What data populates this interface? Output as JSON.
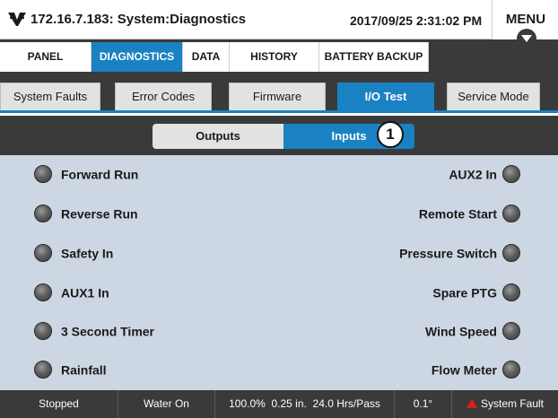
{
  "titlebar": {
    "title": "172.16.7.183: System:Diagnostics",
    "datetime": "2017/09/25 2:31:02 PM",
    "menu_label": "MENU",
    "logo_icon": "rain-bird-logo-icon",
    "menu_arrow_icon": "chevron-down-icon"
  },
  "main_tabs": [
    {
      "label": "PANEL",
      "active": false
    },
    {
      "label": "DIAGNOSTICS",
      "active": true
    },
    {
      "label": "DATA",
      "active": false
    },
    {
      "label": "HISTORY",
      "active": false
    },
    {
      "label": "BATTERY BACKUP",
      "active": false
    }
  ],
  "sub_tabs": [
    {
      "label": "System Faults",
      "active": false
    },
    {
      "label": "Error Codes",
      "active": false
    },
    {
      "label": "Firmware",
      "active": false
    },
    {
      "label": "I/O Test",
      "active": true
    },
    {
      "label": "Service Mode",
      "active": false
    }
  ],
  "toggle": {
    "outputs_label": "Outputs",
    "inputs_label": "Inputs",
    "selected": "Inputs",
    "callout": "1"
  },
  "inputs_left": [
    {
      "label": "Forward Run",
      "state": "off"
    },
    {
      "label": "Reverse Run",
      "state": "off"
    },
    {
      "label": "Safety In",
      "state": "off"
    },
    {
      "label": "AUX1 In",
      "state": "off"
    },
    {
      "label": "3 Second Timer",
      "state": "off"
    },
    {
      "label": "Rainfall",
      "state": "off"
    }
  ],
  "inputs_right": [
    {
      "label": "AUX2 In",
      "state": "off"
    },
    {
      "label": "Remote Start",
      "state": "off"
    },
    {
      "label": "Pressure Switch",
      "state": "off"
    },
    {
      "label": "Spare PTG",
      "state": "off"
    },
    {
      "label": "Wind Speed",
      "state": "off"
    },
    {
      "label": "Flow Meter",
      "state": "off"
    }
  ],
  "statusbar": {
    "state": "Stopped",
    "water": "Water On",
    "speed": "100.0%",
    "depth": "0.25 in.",
    "time_per_pass": "24.0 Hrs/Pass",
    "angle": "0.1°",
    "fault": "System Fault",
    "fault_icon": "warning-triangle-icon"
  },
  "colors": {
    "accent": "#1a82c3",
    "dark": "#3a3a3a",
    "content_bg": "#cdd7e3",
    "fault": "#d62020"
  }
}
